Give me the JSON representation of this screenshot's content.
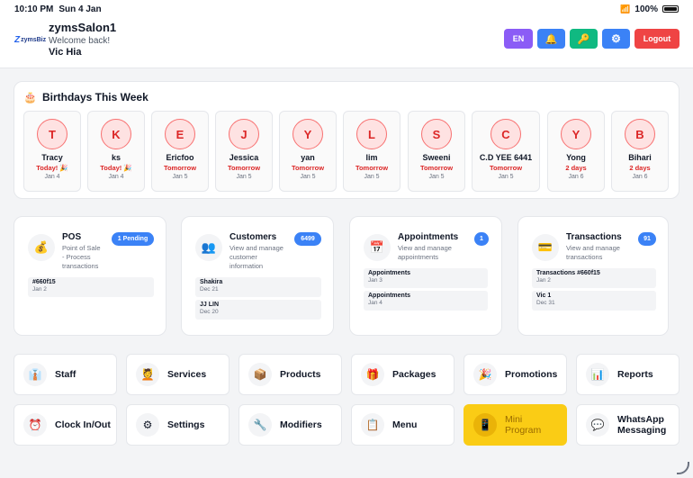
{
  "status_bar": {
    "time": "10:10 PM",
    "date": "Sun 4 Jan",
    "battery": "100%"
  },
  "header": {
    "logo_text": "zymsBiz",
    "shop_name": "zymsSalon1",
    "welcome": "Welcome back!",
    "user_name": "Vic Hia",
    "lang_label": "EN",
    "logout_label": "Logout",
    "colors": {
      "lang": "#8b5cf6",
      "bell": "#3b82f6",
      "key": "#10b981",
      "settings": "#3b82f6",
      "logout": "#ef4444"
    }
  },
  "birthdays": {
    "title": "Birthdays This Week",
    "icon": "cake-icon",
    "items": [
      {
        "initial": "T",
        "name": "Tracy",
        "when": "Today! 🎉",
        "date": "Jan 4"
      },
      {
        "initial": "K",
        "name": "ks",
        "when": "Today! 🎉",
        "date": "Jan 4"
      },
      {
        "initial": "E",
        "name": "Ericfoo",
        "when": "Tomorrow",
        "date": "Jan 5"
      },
      {
        "initial": "J",
        "name": "Jessica",
        "when": "Tomorrow",
        "date": "Jan 5"
      },
      {
        "initial": "Y",
        "name": "yan",
        "when": "Tomorrow",
        "date": "Jan 5"
      },
      {
        "initial": "L",
        "name": "lim",
        "when": "Tomorrow",
        "date": "Jan 5"
      },
      {
        "initial": "S",
        "name": "Sweeni",
        "when": "Tomorrow",
        "date": "Jan 5"
      },
      {
        "initial": "C",
        "name": "C.D YEE 6441",
        "when": "Tomorrow",
        "date": "Jan 5"
      },
      {
        "initial": "Y",
        "name": "Yong",
        "when": "2 days",
        "date": "Jan 6"
      },
      {
        "initial": "B",
        "name": "Bihari",
        "when": "2 days",
        "date": "Jan 6"
      }
    ]
  },
  "modules": {
    "pos": {
      "title": "POS",
      "icon": "money-bag-icon",
      "desc": [
        "Point of Sale",
        "- Process",
        "transactions"
      ],
      "badge": "1 Pending",
      "rows": [
        {
          "a": "#660f15",
          "b": "Jan 2"
        }
      ]
    },
    "customers": {
      "title": "Customers",
      "icon": "people-icon",
      "desc": [
        "View and manage",
        "customer",
        "information"
      ],
      "badge": "6499",
      "rows": [
        {
          "a": "Shakira",
          "b": "Dec 21"
        },
        {
          "a": "JJ LIN",
          "b": "Dec 20"
        }
      ]
    },
    "appointments": {
      "title": "Appointments",
      "icon": "calendar-icon",
      "desc": [
        "View and manage",
        "appointments"
      ],
      "badge": "1",
      "rows": [
        {
          "a": "Appointments",
          "b": "Jan 3"
        },
        {
          "a": "Appointments",
          "b": "Jan 4"
        }
      ]
    },
    "transactions": {
      "title": "Transactions",
      "icon": "credit-card-icon",
      "desc": [
        "View and manage",
        "transactions"
      ],
      "badge": "91",
      "rows": [
        {
          "a": "Transactions #660f15",
          "b": "Jan 2"
        },
        {
          "a": "Vic 1",
          "b": "Dec 31"
        }
      ]
    }
  },
  "nav": [
    {
      "label": "Staff",
      "icon": "staff-icon",
      "glyph": "👔"
    },
    {
      "label": "Services",
      "icon": "services-icon",
      "glyph": "💆"
    },
    {
      "label": "Products",
      "icon": "box-icon",
      "glyph": "📦"
    },
    {
      "label": "Packages",
      "icon": "gift-icon",
      "glyph": "🎁"
    },
    {
      "label": "Promotions",
      "icon": "party-popper-icon",
      "glyph": "🎉"
    },
    {
      "label": "Reports",
      "icon": "bar-chart-icon",
      "glyph": "📊"
    },
    {
      "label": "Clock In/Out",
      "icon": "alarm-clock-icon",
      "glyph": "⏰"
    },
    {
      "label": "Settings",
      "icon": "gear-icon",
      "glyph": "⚙"
    },
    {
      "label": "Modifiers",
      "icon": "wrench-icon",
      "glyph": "🔧"
    },
    {
      "label": "Menu",
      "icon": "menu-icon",
      "glyph": "📋"
    },
    {
      "label": "Mini Program",
      "icon": "mobile-phone-icon",
      "glyph": "📱",
      "highlight_color": "#facc15"
    },
    {
      "label": "WhatsApp Messaging",
      "icon": "chat-bubble-icon",
      "glyph": "💬"
    }
  ]
}
